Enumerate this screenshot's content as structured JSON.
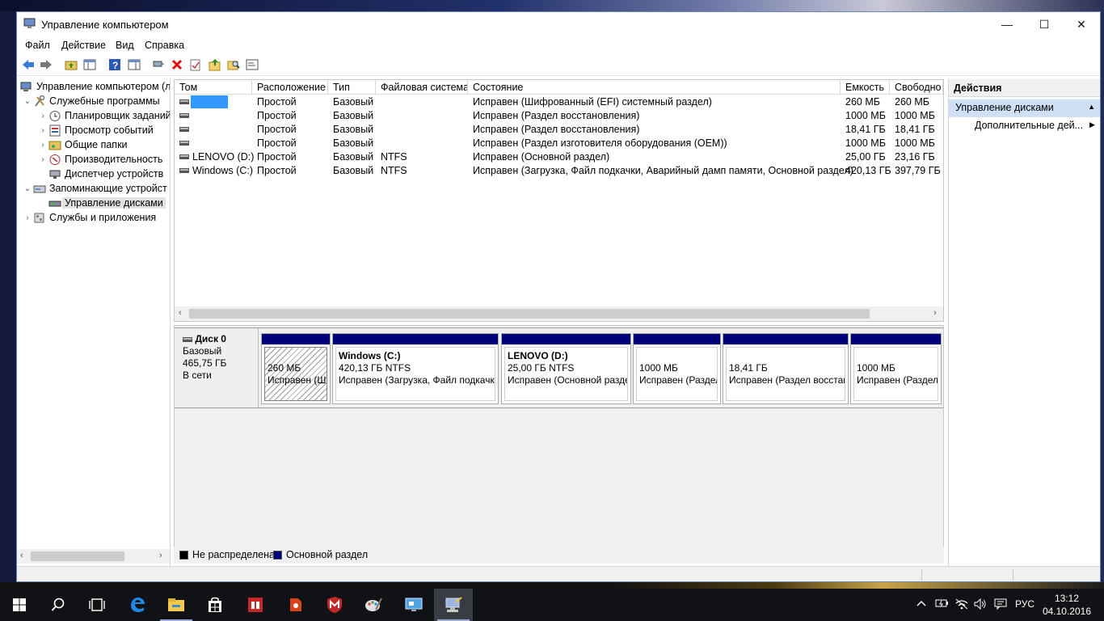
{
  "window": {
    "title": "Управление компьютером",
    "min": "—",
    "max": "☐",
    "close": "✕"
  },
  "menu": [
    "Файл",
    "Действие",
    "Вид",
    "Справка"
  ],
  "tree": {
    "root": "Управление компьютером (л",
    "items": [
      {
        "label": "Служебные программы"
      },
      {
        "label": "Планировщик заданий"
      },
      {
        "label": "Просмотр событий"
      },
      {
        "label": "Общие папки"
      },
      {
        "label": "Производительность"
      },
      {
        "label": "Диспетчер устройств"
      },
      {
        "label": "Запоминающие устройст"
      },
      {
        "label": "Управление дисками"
      },
      {
        "label": "Службы и приложения"
      }
    ]
  },
  "volumes": {
    "columns": [
      "Том",
      "Расположение",
      "Тип",
      "Файловая система",
      "Состояние",
      "Емкость",
      "Свободно"
    ],
    "rows": [
      {
        "name": "",
        "layout": "Простой",
        "type": "Базовый",
        "fs": "",
        "status": "Исправен (Шифрованный (EFI) системный раздел)",
        "capacity": "260 МБ",
        "free": "260 МБ"
      },
      {
        "name": "",
        "layout": "Простой",
        "type": "Базовый",
        "fs": "",
        "status": "Исправен (Раздел восстановления)",
        "capacity": "1000 МБ",
        "free": "1000 МБ"
      },
      {
        "name": "",
        "layout": "Простой",
        "type": "Базовый",
        "fs": "",
        "status": "Исправен (Раздел восстановления)",
        "capacity": "18,41 ГБ",
        "free": "18,41 ГБ"
      },
      {
        "name": "",
        "layout": "Простой",
        "type": "Базовый",
        "fs": "",
        "status": "Исправен (Раздел изготовителя оборудования (OEM))",
        "capacity": "1000 МБ",
        "free": "1000 МБ"
      },
      {
        "name": "LENOVO (D:)",
        "layout": "Простой",
        "type": "Базовый",
        "fs": "NTFS",
        "status": "Исправен (Основной раздел)",
        "capacity": "25,00 ГБ",
        "free": "23,16 ГБ"
      },
      {
        "name": "Windows (C:)",
        "layout": "Простой",
        "type": "Базовый",
        "fs": "NTFS",
        "status": "Исправен (Загрузка, Файл подкачки, Аварийный дамп памяти, Основной раздел)",
        "capacity": "420,13 ГБ",
        "free": "397,79 ГБ"
      }
    ]
  },
  "disk": {
    "name": "Диск 0",
    "type": "Базовый",
    "size": "465,75 ГБ",
    "state": "В сети",
    "partitions": [
      {
        "title": "",
        "size": "260 МБ",
        "status": "Исправен (Ш"
      },
      {
        "title": "Windows  (C:)",
        "size": "420,13 ГБ NTFS",
        "status": "Исправен (Загрузка, Файл подкачк"
      },
      {
        "title": "LENOVO  (D:)",
        "size": "25,00 ГБ NTFS",
        "status": "Исправен (Основной разде"
      },
      {
        "title": "",
        "size": "1000 МБ",
        "status": "Исправен (Раздел"
      },
      {
        "title": "",
        "size": "18,41 ГБ",
        "status": "Исправен (Раздел восстан"
      },
      {
        "title": "",
        "size": "1000 МБ",
        "status": "Исправен (Раздел"
      }
    ]
  },
  "legend": [
    {
      "label": "Не распределена",
      "color": "#000000"
    },
    {
      "label": "Основной раздел",
      "color": "#00007a"
    }
  ],
  "actions": {
    "header": "Действия",
    "section": "Управление дисками",
    "item": "Дополнительные дей..."
  },
  "taskbar": {
    "icons": [
      "windows-start-icon",
      "search-icon",
      "task-view-icon",
      "edge-icon",
      "file-explorer-icon",
      "store-icon",
      "reader-icon",
      "app-icon",
      "mcafee-icon",
      "paint-icon",
      "rdp-icon",
      "computer-management-icon"
    ],
    "language": "РУС",
    "time": "13:12",
    "date": "04.10.2016"
  },
  "colors": {
    "primary_partition": "#00007a",
    "selection": "#3399ff",
    "accent": "#cfe0f5"
  }
}
